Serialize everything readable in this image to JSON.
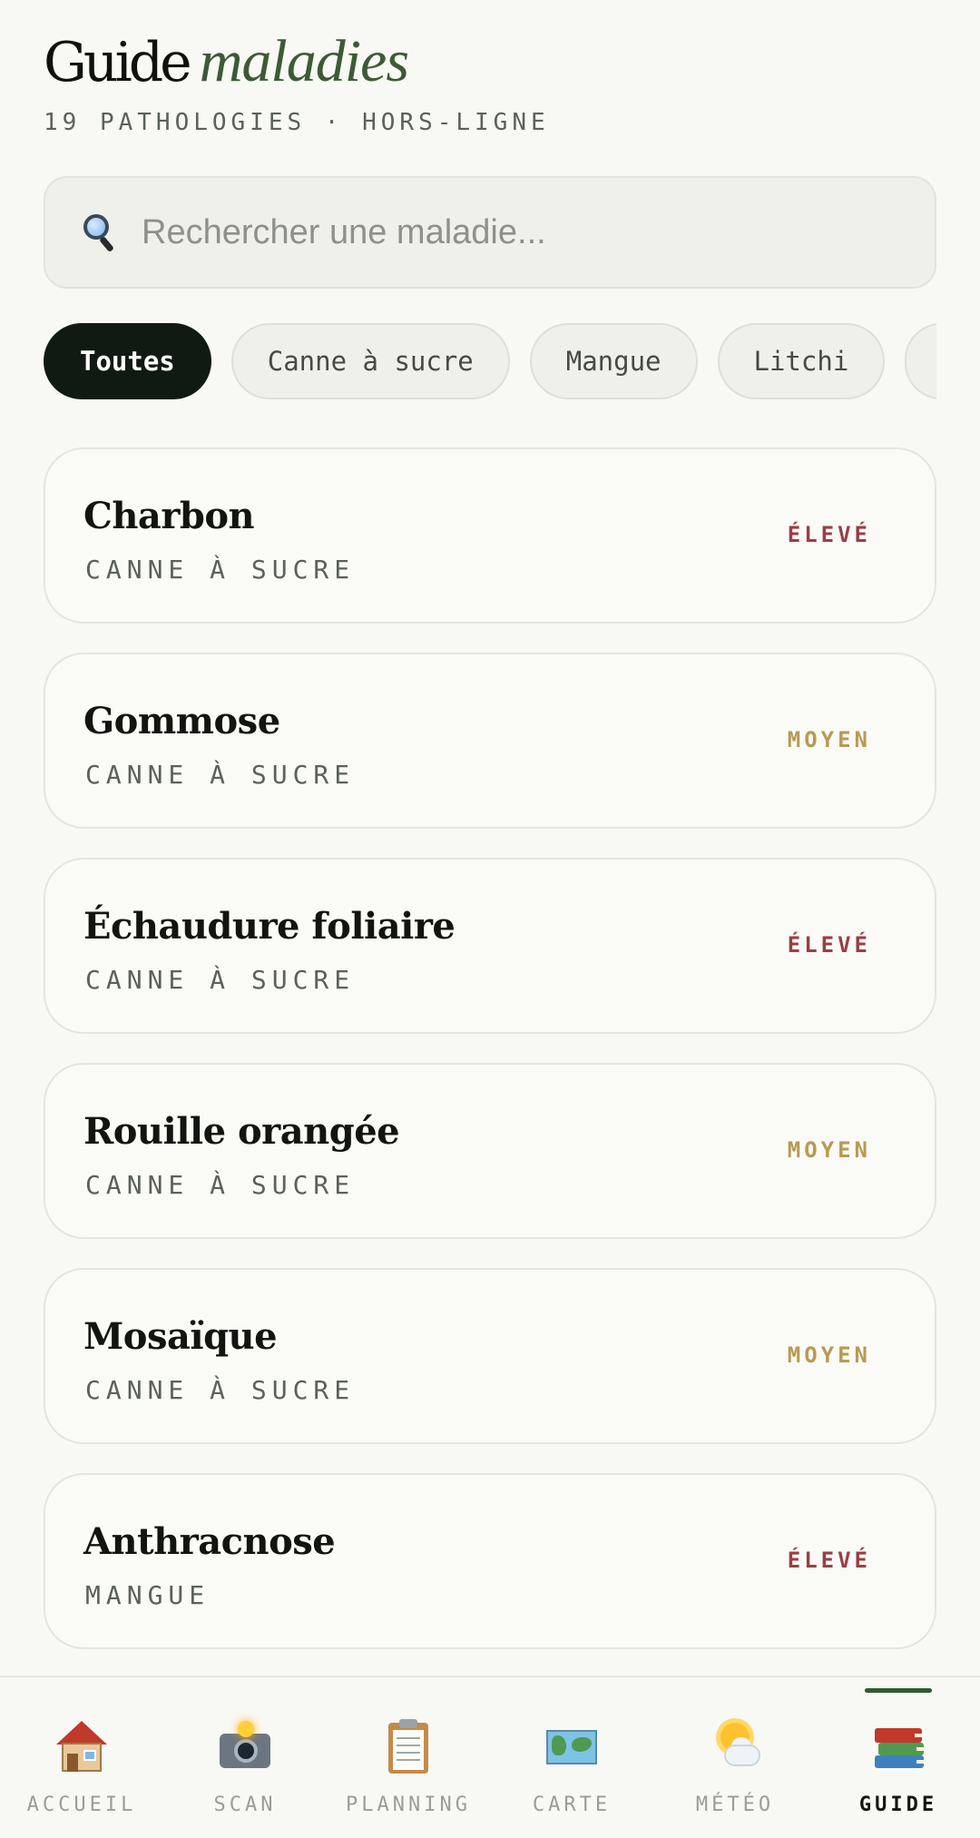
{
  "header": {
    "title_main": "Guide",
    "title_accent": "maladies",
    "subtitle": "19 PATHOLOGIES · HORS-LIGNE"
  },
  "search": {
    "placeholder": "Rechercher une maladie...",
    "value": "",
    "icon": "magnifier-icon"
  },
  "filters": [
    {
      "label": "Toutes",
      "active": true
    },
    {
      "label": "Canne à sucre",
      "active": false
    },
    {
      "label": "Mangue",
      "active": false
    },
    {
      "label": "Litchi",
      "active": false
    },
    {
      "label": "",
      "active": false
    }
  ],
  "diseases": [
    {
      "name": "Charbon",
      "crop": "CANNE À SUCRE",
      "level": "ÉLEVÉ",
      "level_color": "#9a3f44"
    },
    {
      "name": "Gommose",
      "crop": "CANNE À SUCRE",
      "level": "MOYEN",
      "level_color": "#b89a52"
    },
    {
      "name": "Échaudure foliaire",
      "crop": "CANNE À SUCRE",
      "level": "ÉLEVÉ",
      "level_color": "#9a3f44"
    },
    {
      "name": "Rouille orangée",
      "crop": "CANNE À SUCRE",
      "level": "MOYEN",
      "level_color": "#b89a52"
    },
    {
      "name": "Mosaïque",
      "crop": "CANNE À SUCRE",
      "level": "MOYEN",
      "level_color": "#b89a52"
    },
    {
      "name": "Anthracnose",
      "crop": "MANGUE",
      "level": "ÉLEVÉ",
      "level_color": "#9a3f44"
    }
  ],
  "nav": [
    {
      "label": "ACCUEIL",
      "icon": "house-icon",
      "active": false
    },
    {
      "label": "SCAN",
      "icon": "camera-flash-icon",
      "active": false
    },
    {
      "label": "PLANNING",
      "icon": "clipboard-icon",
      "active": false
    },
    {
      "label": "CARTE",
      "icon": "world-map-icon",
      "active": false
    },
    {
      "label": "MÉTÉO",
      "icon": "sun-behind-cloud-icon",
      "active": false
    },
    {
      "label": "GUIDE",
      "icon": "books-icon",
      "active": true
    }
  ],
  "colors": {
    "accent": "#3d5a37",
    "active_chip": "#101a12",
    "nav_indicator": "#2f5a34",
    "level_high": "#9a3f44",
    "level_medium": "#b89a52"
  }
}
